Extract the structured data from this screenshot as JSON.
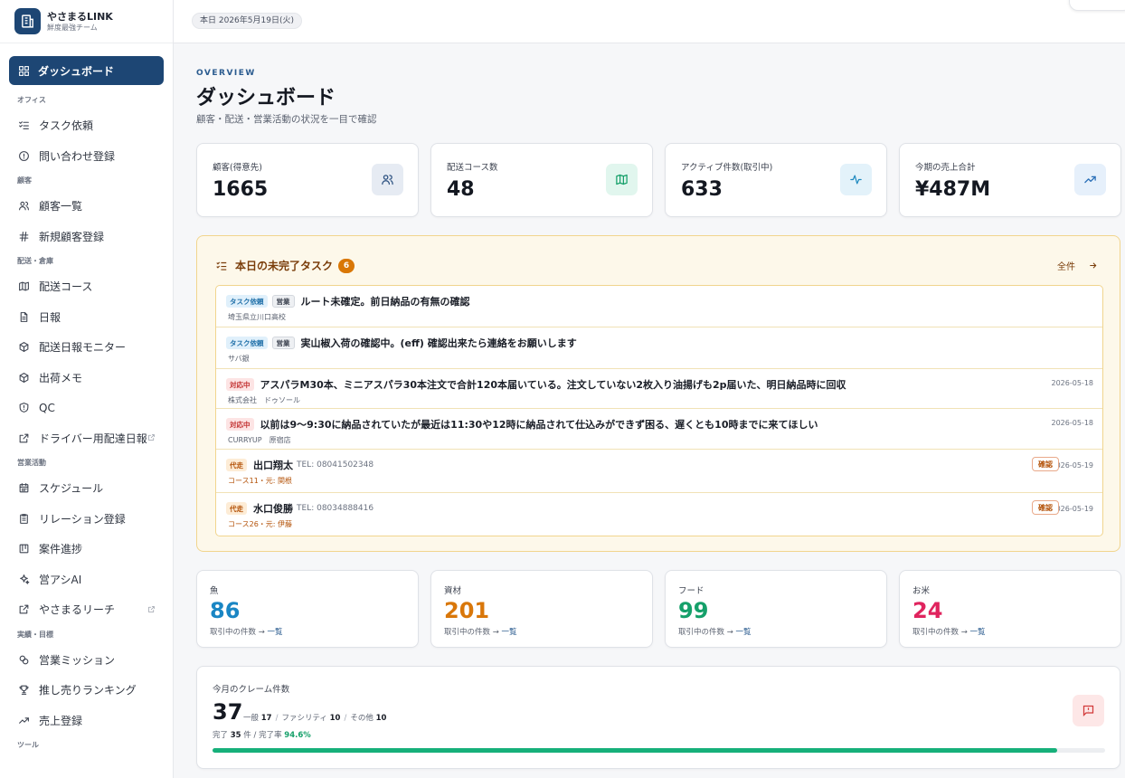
{
  "brand": {
    "name": "やさまるLINK",
    "sub": "鮮度最強チーム"
  },
  "topbar": {
    "date": "本日 2026年5月19日(火)"
  },
  "nav": {
    "active": "ダッシュボード",
    "sections": [
      {
        "label": "オフィス",
        "items": [
          {
            "label": "タスク依頼",
            "icon": "checklist-icon"
          },
          {
            "label": "問い合わせ登録",
            "icon": "alert-circle-icon"
          }
        ]
      },
      {
        "label": "顧客",
        "items": [
          {
            "label": "顧客一覧",
            "icon": "users-icon"
          },
          {
            "label": "新規顧客登録",
            "icon": "hash-icon"
          }
        ]
      },
      {
        "label": "配送・倉庫",
        "items": [
          {
            "label": "配送コース",
            "icon": "map-icon"
          },
          {
            "label": "日報",
            "icon": "file-icon"
          },
          {
            "label": "配送日報モニター",
            "icon": "package-icon"
          },
          {
            "label": "出荷メモ",
            "icon": "package-icon"
          },
          {
            "label": "QC",
            "icon": "shield-icon"
          },
          {
            "label": "ドライバー用配達日報",
            "icon": "external-link-icon",
            "external": true
          }
        ]
      },
      {
        "label": "営業活動",
        "items": [
          {
            "label": "スケジュール",
            "icon": "calendar-icon"
          },
          {
            "label": "リレーション登録",
            "icon": "clipboard-icon"
          },
          {
            "label": "案件進捗",
            "icon": "kanban-icon"
          },
          {
            "label": "営アシAI",
            "icon": "sparkles-icon"
          },
          {
            "label": "やさまるリーチ",
            "icon": "external-link-icon",
            "external": true
          }
        ]
      },
      {
        "label": "実績・目標",
        "items": [
          {
            "label": "営業ミッション",
            "icon": "target-icon"
          },
          {
            "label": "推し売りランキング",
            "icon": "trophy-icon"
          },
          {
            "label": "売上登録",
            "icon": "trending-up-icon"
          }
        ]
      },
      {
        "label": "ツール",
        "items": []
      }
    ]
  },
  "header": {
    "overline": "OVERVIEW",
    "title": "ダッシュボード",
    "subtitle": "顧客・配送・営業活動の状況を一目で確認"
  },
  "stats": [
    {
      "label": "顧客(得意先)",
      "value": "1665",
      "icon": "users-icon",
      "bg": "#e6ebf3",
      "fg": "#2a4f7f"
    },
    {
      "label": "配送コース数",
      "value": "48",
      "icon": "map-icon",
      "bg": "#e1f6ee",
      "fg": "#16a06a"
    },
    {
      "label": "アクティブ件数(取引中)",
      "value": "633",
      "icon": "activity-icon",
      "bg": "#e3f2fa",
      "fg": "#1f8ac0"
    },
    {
      "label": "今期の売上合計",
      "value": "¥487M",
      "icon": "trending-up-icon",
      "bg": "#e6f0fb",
      "fg": "#2a6fb8"
    }
  ],
  "tasks": {
    "title": "本日の未完了タスク",
    "count": "6",
    "all_label": "全件",
    "rows": [
      {
        "badges": [
          "タスク依頼",
          "営業"
        ],
        "text": "ルート未確定。前日納品の有無の確認",
        "sub": "埼玉県立川口高校"
      },
      {
        "badges": [
          "タスク依頼",
          "営業"
        ],
        "text": "実山椒入荷の確認中。(eff) 確認出来たら連絡をお願いします",
        "sub": "サバ銀"
      },
      {
        "badges": [
          "対応中"
        ],
        "text": "アスパラM30本、ミニアスパラ30本注文で合計120本届いている。注文していない2枚入り油揚げも2p届いた、明日納品時に回収",
        "sub": "株式会社　ドゥソール",
        "date": "2026-05-18"
      },
      {
        "badges": [
          "対応中"
        ],
        "text": "以前は9〜9:30に納品されていたが最近は11:30や12時に納品されて仕込みができず困る、遅くとも10時までに来てほしい",
        "sub": "CURRYUP　原宿店",
        "date": "2026-05-18"
      },
      {
        "badges": [
          "代走"
        ],
        "text": "出口翔太",
        "tel": "TEL: 08041502348",
        "sub": "コース11・元: 関根",
        "date": "2026-05-19",
        "action": "確認"
      },
      {
        "badges": [
          "代走"
        ],
        "text": "水口俊勝",
        "tel": "TEL: 08034888416",
        "sub": "コース26・元: 伊藤",
        "date": "2026-05-19",
        "action": "確認"
      }
    ]
  },
  "categories": [
    {
      "label": "魚",
      "value": "86",
      "color": "#1a86c4",
      "link_prefix": "取引中の件数 → ",
      "link": "一覧"
    },
    {
      "label": "資材",
      "value": "201",
      "color": "#d9770a",
      "link_prefix": "取引中の件数 → ",
      "link": "一覧"
    },
    {
      "label": "フード",
      "value": "99",
      "color": "#15a06a",
      "link_prefix": "取引中の件数 → ",
      "link": "一覧"
    },
    {
      "label": "お米",
      "value": "24",
      "color": "#e0245e",
      "link_prefix": "取引中の件数 → ",
      "link": "一覧"
    }
  ],
  "claims": {
    "label": "今月のクレーム件数",
    "value": "37",
    "general_label": "一般",
    "general": "17",
    "facility_label": "ファシリティ",
    "facility": "10",
    "other_label": "その他",
    "other": "10",
    "done_label": "完了",
    "done": "35",
    "done_unit": "件",
    "rate_label": "完了率",
    "rate": "94.6%",
    "progress": 0.946
  }
}
